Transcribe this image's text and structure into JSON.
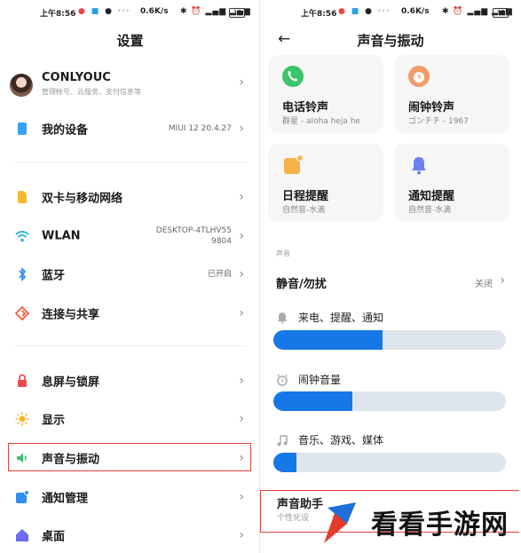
{
  "left": {
    "status": {
      "time": "上午8:56",
      "speed": "0.6K/s",
      "battery": "37"
    },
    "title": "设置",
    "account": {
      "name": "CONLYOUC",
      "subtitle": "管理帐号、云服务、支付信息等"
    },
    "device": {
      "label": "我的设备",
      "value": "MIUI 12 20.4.27"
    },
    "items": [
      {
        "label": "双卡与移动网络",
        "value": ""
      },
      {
        "label": "WLAN",
        "value_line1": "DESKTOP-4TLHV55",
        "value_line2": "9804"
      },
      {
        "label": "蓝牙",
        "value": "已开启"
      },
      {
        "label": "连接与共享",
        "value": ""
      },
      {
        "label": "息屏与锁屏",
        "value": ""
      },
      {
        "label": "显示",
        "value": ""
      },
      {
        "label": "声音与振动",
        "value": ""
      },
      {
        "label": "通知管理",
        "value": ""
      },
      {
        "label": "桌面",
        "value": ""
      }
    ],
    "chevron": "›"
  },
  "right": {
    "status": {
      "time": "上午8:56",
      "speed": "0.6K/s",
      "battery": "37"
    },
    "title": "声音与振动",
    "back": "←",
    "cards": [
      {
        "title": "电话铃声",
        "subtitle": "群星 - aloha heja he",
        "color": "#3cc46a"
      },
      {
        "title": "闹钟铃声",
        "subtitle": "ゴンチチ - 1967",
        "color": "#f49a6a"
      },
      {
        "title": "日程提醒",
        "subtitle": "自然音-水滴",
        "color": "#f7b24a"
      },
      {
        "title": "通知提醒",
        "subtitle": "自然音-水滴",
        "color": "#6c82f0"
      }
    ],
    "section_label": "声音",
    "mute": {
      "label": "静音/勿扰",
      "value": "关闭"
    },
    "volumes": [
      {
        "label": "来电、提醒、通知",
        "level": 0.47
      },
      {
        "label": "闹钟音量",
        "level": 0.34
      },
      {
        "label": "音乐、游戏、媒体",
        "level": 0.1
      }
    ],
    "assistant": {
      "title": "声音助手",
      "subtitle": "个性化设"
    }
  },
  "watermark": {
    "text": "看看手游网"
  },
  "colors": {
    "accent": "#1677e6",
    "highlight": "#e0403a",
    "track": "#dfe5ec"
  }
}
